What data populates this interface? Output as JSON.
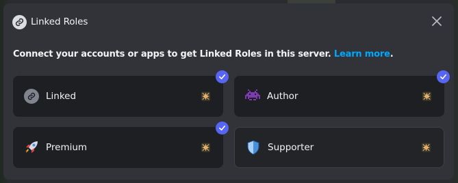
{
  "modal": {
    "title": "Linked Roles",
    "subtitle": "Connect your accounts or apps to get Linked Roles in this server.",
    "learn_more": "Learn more",
    "period": "."
  },
  "roles": [
    {
      "label": "Linked",
      "icon": "link-icon",
      "checked": true
    },
    {
      "label": "Author",
      "icon": "space-invader-icon",
      "checked": true
    },
    {
      "label": "Premium",
      "icon": "rocket-icon",
      "checked": true
    },
    {
      "label": "Supporter",
      "icon": "shield-icon",
      "checked": false
    }
  ],
  "colors": {
    "accent": "#5865f2",
    "link": "#00a8fc",
    "author_icon": "#7d3bb0",
    "shield": "#4a90d9"
  }
}
